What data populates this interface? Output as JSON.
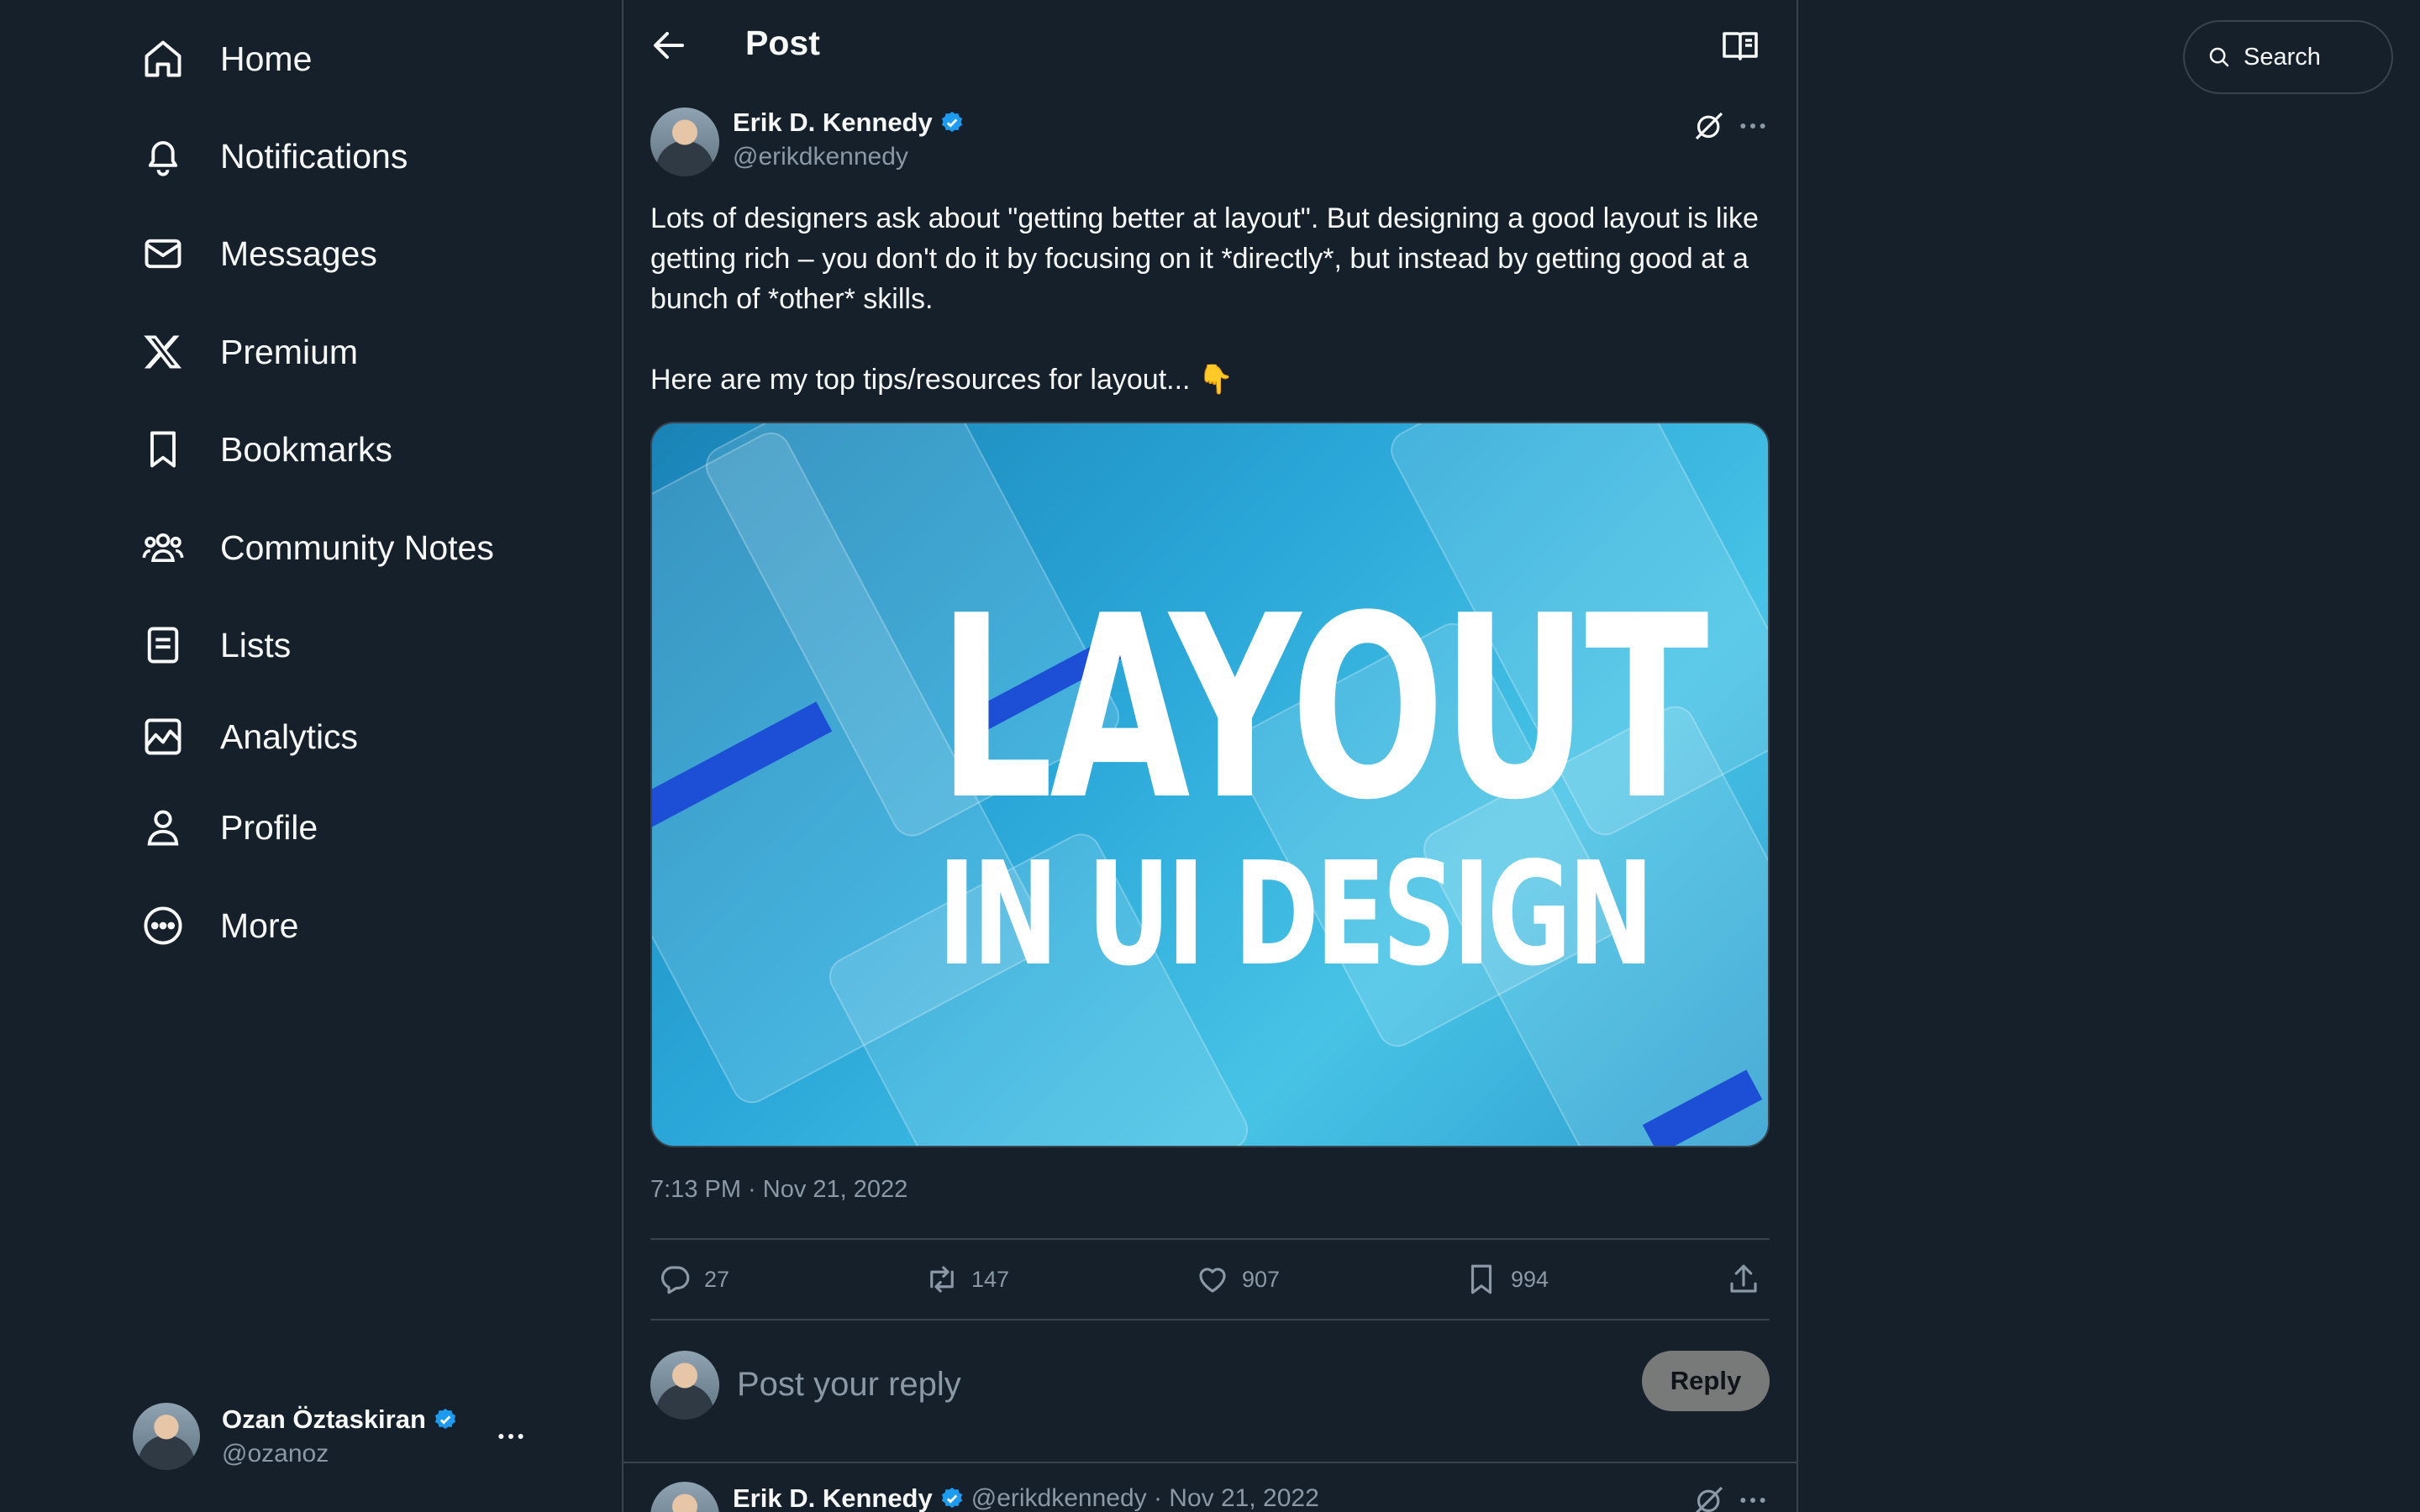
{
  "nav": {
    "items": [
      {
        "label": "Home",
        "icon": "home-icon"
      },
      {
        "label": "Notifications",
        "icon": "bell-icon"
      },
      {
        "label": "Messages",
        "icon": "envelope-icon"
      },
      {
        "label": "Premium",
        "icon": "x-logo-icon"
      },
      {
        "label": "Bookmarks",
        "icon": "bookmark-icon"
      },
      {
        "label": "Community Notes",
        "icon": "people-icon"
      },
      {
        "label": "Lists",
        "icon": "list-icon"
      },
      {
        "label": "Analytics",
        "icon": "chart-icon"
      },
      {
        "label": "Profile",
        "icon": "person-icon"
      },
      {
        "label": "More",
        "icon": "more-circle-icon"
      }
    ]
  },
  "account": {
    "name": "Ozan Öztaskiran",
    "handle": "@ozanoz"
  },
  "header": {
    "title": "Post"
  },
  "post": {
    "author_name": "Erik D. Kennedy",
    "author_handle": "@erikdkennedy",
    "text": "Lots of designers ask about \"getting better at layout\". But designing a good layout is like getting rich – you don't do it by focusing on it *directly*, but instead by getting good at a bunch of *other* skills.\n\nHere are my top tips/resources for layout... 👇",
    "media_title_line1": "LAYOUT",
    "media_title_line2": "IN UI DESIGN",
    "timestamp": "7:13 PM · Nov 21, 2022",
    "replies": "27",
    "reposts": "147",
    "likes": "907",
    "bookmarks": "994"
  },
  "reply": {
    "placeholder": "Post your reply",
    "button_label": "Reply"
  },
  "next_post": {
    "author_name": "Erik D. Kennedy",
    "meta": "@erikdkennedy · Nov 21, 2022"
  },
  "search": {
    "placeholder": "Search"
  },
  "colors": {
    "background": "#15202b",
    "border": "#38444d",
    "muted": "#8b98a5",
    "verified": "#1d9bf0",
    "text": "#f7f9f9"
  }
}
